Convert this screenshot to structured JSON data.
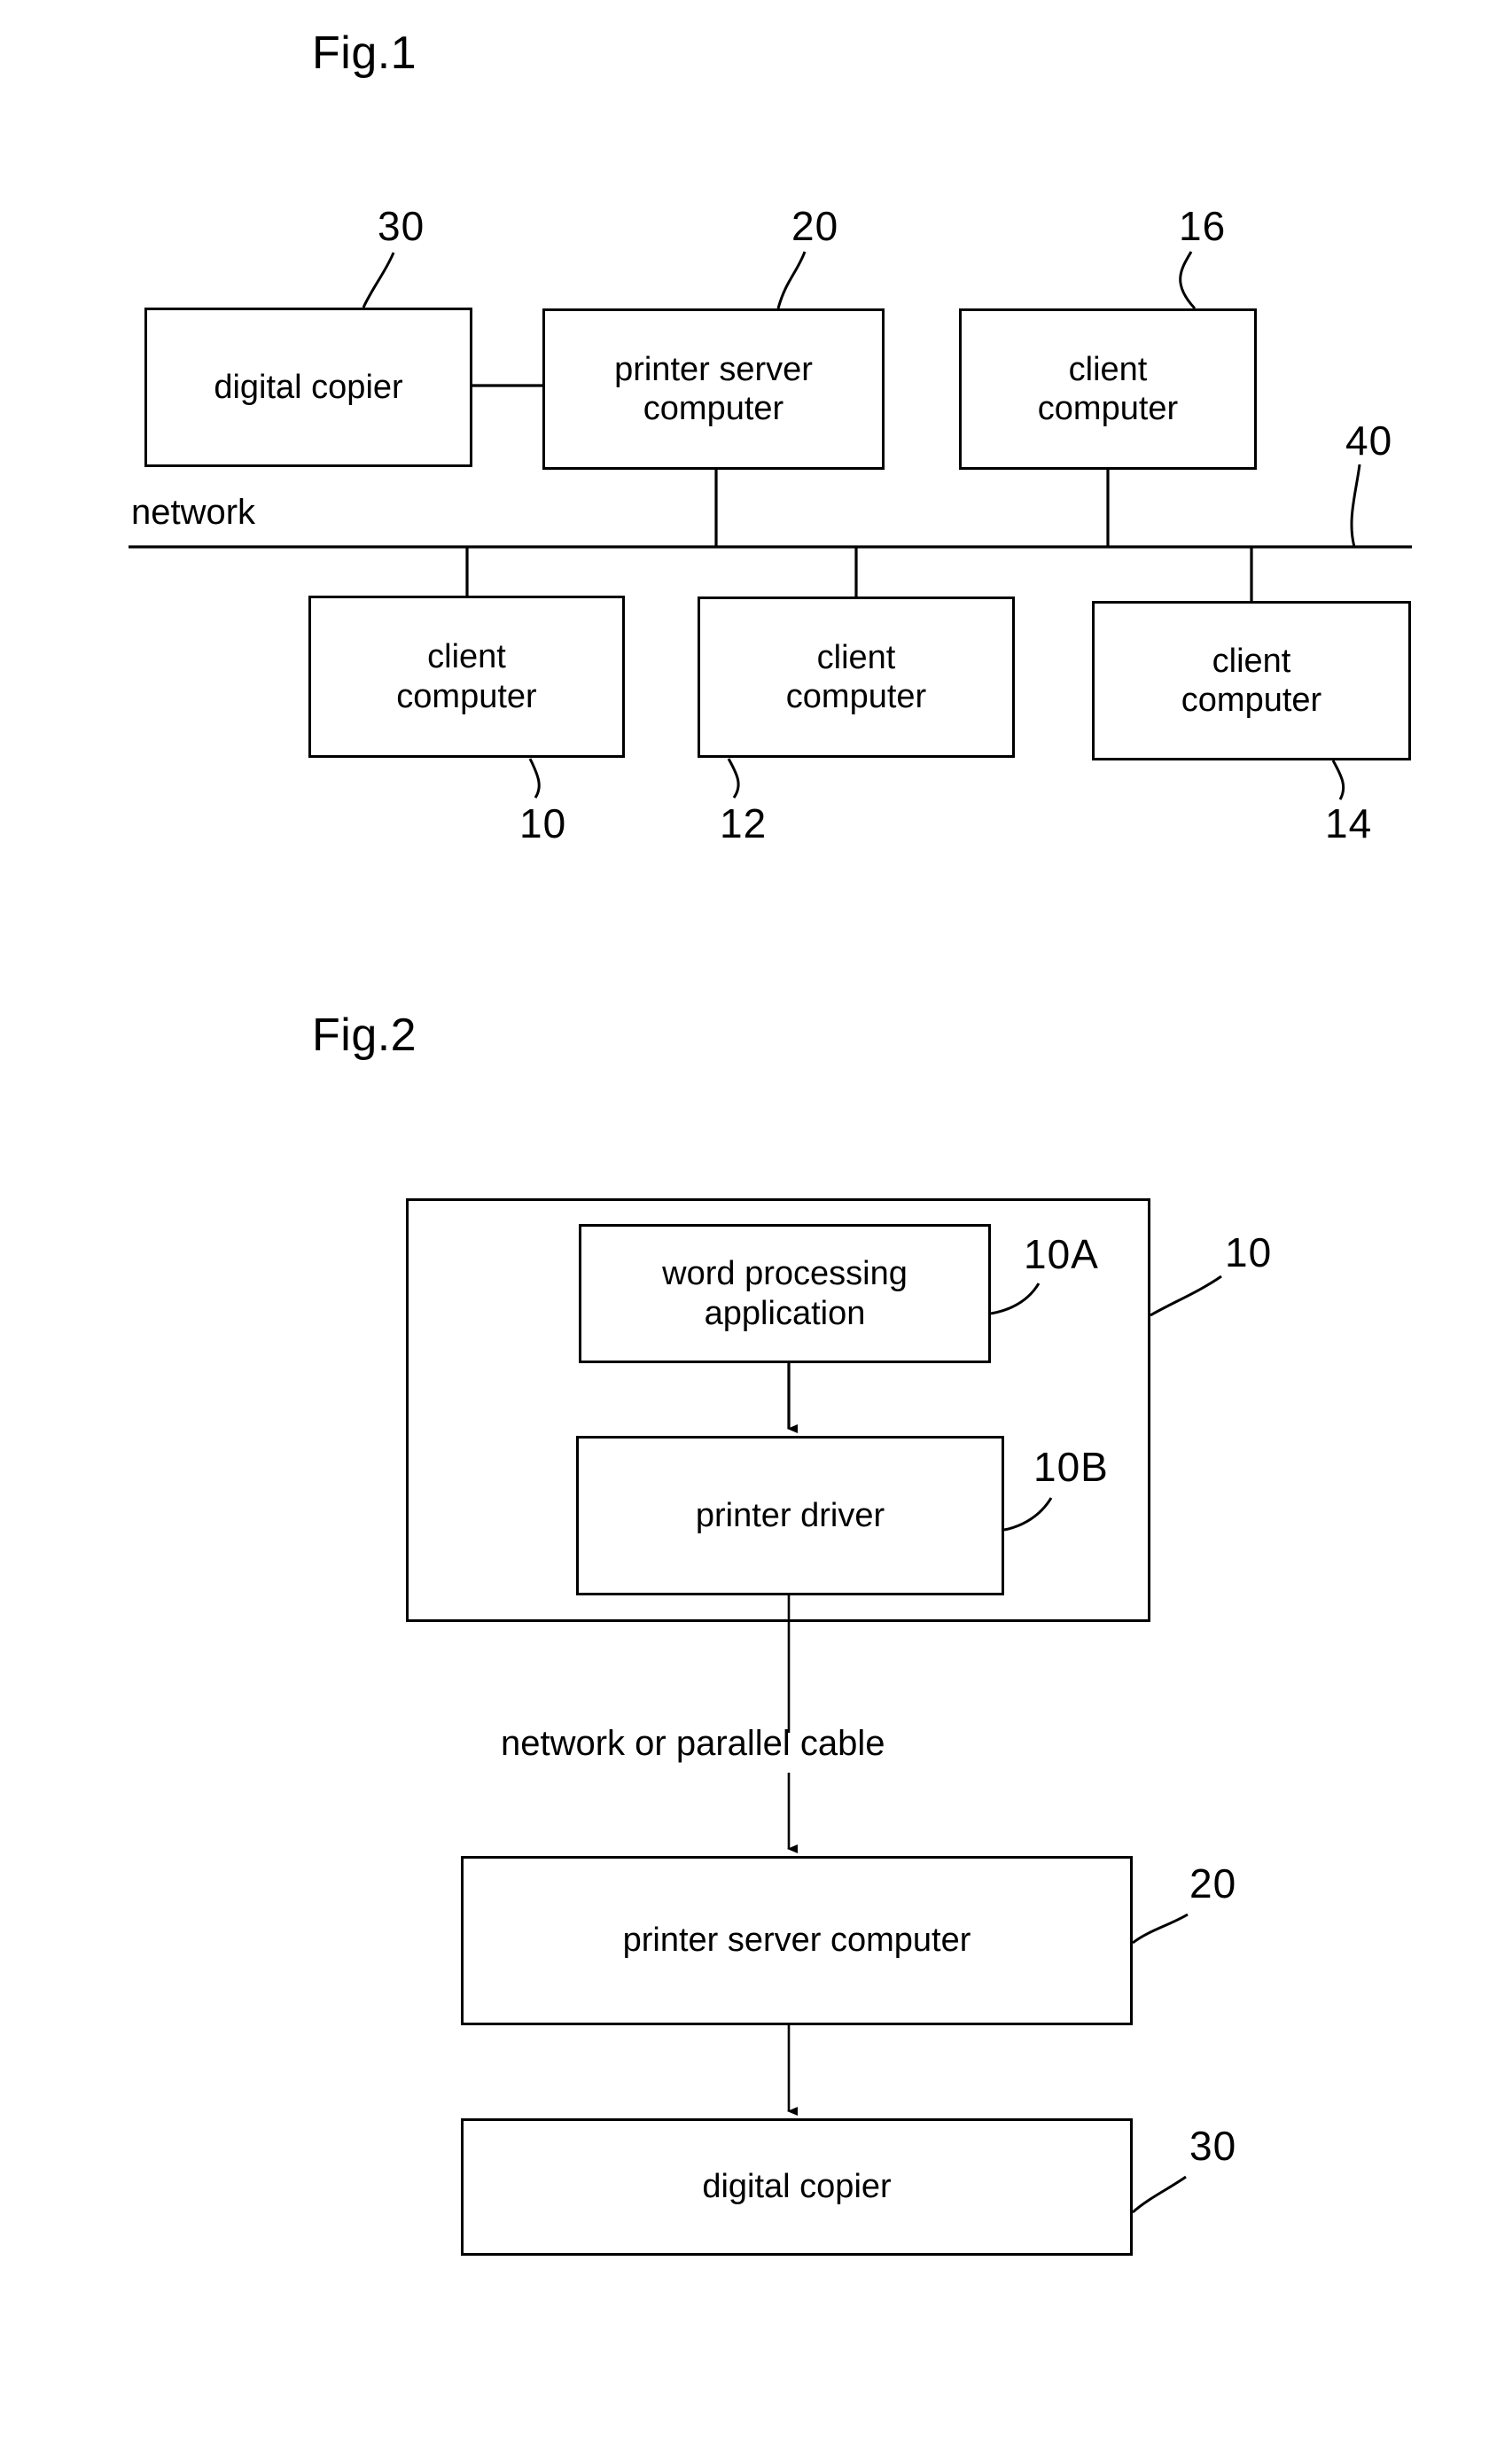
{
  "page": {
    "background": "#ffffff",
    "ink": "#000000"
  },
  "figures": [
    {
      "id": "fig1",
      "label": "Fig.1",
      "bus_label": "network",
      "nodes": [
        {
          "key": "digital_copier",
          "label": "digital copier",
          "ref": "30"
        },
        {
          "key": "printer_server",
          "label": "printer server\ncomputer",
          "ref": "20"
        },
        {
          "key": "client_16",
          "label": "client\ncomputer",
          "ref": "16"
        },
        {
          "key": "client_10",
          "label": "client\ncomputer",
          "ref": "10"
        },
        {
          "key": "client_12",
          "label": "client\ncomputer",
          "ref": "12"
        },
        {
          "key": "client_14",
          "label": "client\ncomputer",
          "ref": "14"
        }
      ],
      "bus_ref": "40"
    },
    {
      "id": "fig2",
      "label": "Fig.2",
      "container_ref": "10",
      "link_label": "network or parallel cable",
      "nodes": [
        {
          "key": "word_app",
          "label": "word processing\napplication",
          "ref": "10A"
        },
        {
          "key": "printer_driver",
          "label": "printer driver",
          "ref": "10B"
        },
        {
          "key": "printer_server",
          "label": "printer server computer",
          "ref": "20"
        },
        {
          "key": "digital_copier",
          "label": "digital copier",
          "ref": "30"
        }
      ]
    }
  ],
  "fig1": {
    "title": "Fig.1",
    "network_label": "network",
    "box_digital_copier": "digital copier",
    "box_printer_server": "printer server\ncomputer",
    "box_client_16": "client\ncomputer",
    "box_client_10": "client\ncomputer",
    "box_client_12": "client\ncomputer",
    "box_client_14": "client\ncomputer",
    "ref_30": "30",
    "ref_20": "20",
    "ref_16": "16",
    "ref_40": "40",
    "ref_10": "10",
    "ref_12": "12",
    "ref_14": "14"
  },
  "fig2": {
    "title": "Fig.2",
    "box_word_app": "word processing\napplication",
    "box_printer_driver": "printer driver",
    "box_printer_server": "printer server computer",
    "box_digital_copier": "digital copier",
    "cable_label": "network or parallel cable",
    "ref_10A": "10A",
    "ref_10B": "10B",
    "ref_10": "10",
    "ref_20": "20",
    "ref_30": "30"
  }
}
